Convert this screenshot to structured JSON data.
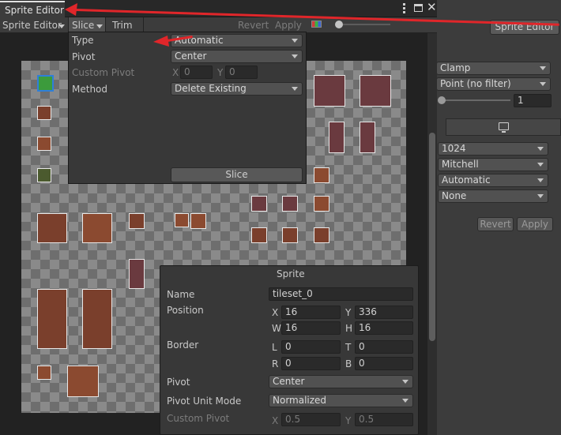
{
  "window": {
    "tab_title": "Sprite Editor",
    "toolbar": {
      "sprite_editor_menu": "Sprite Editor",
      "slice_menu": "Slice",
      "trim_button": "Trim",
      "revert_button": "Revert",
      "apply_button": "Apply"
    }
  },
  "slice_popup": {
    "type_label": "Type",
    "type_value": "Automatic",
    "pivot_label": "Pivot",
    "pivot_value": "Center",
    "custom_pivot_label": "Custom Pivot",
    "x_label": "X",
    "x_value": "0",
    "y_label": "Y",
    "y_value": "0",
    "method_label": "Method",
    "method_value": "Delete Existing",
    "slice_button": "Slice"
  },
  "sprite_panel": {
    "title": "Sprite",
    "name_label": "Name",
    "name_value": "tileset_0",
    "position_label": "Position",
    "pos_x_label": "X",
    "pos_x": "16",
    "pos_y_label": "Y",
    "pos_y": "336",
    "pos_w_label": "W",
    "pos_w": "16",
    "pos_h_label": "H",
    "pos_h": "16",
    "border_label": "Border",
    "border_l_label": "L",
    "border_l": "0",
    "border_t_label": "T",
    "border_t": "0",
    "border_r_label": "R",
    "border_r": "0",
    "border_b_label": "B",
    "border_b": "0",
    "pivot_label": "Pivot",
    "pivot_value": "Center",
    "pivot_unit_mode_label": "Pivot Unit Mode",
    "pivot_unit_mode_value": "Normalized",
    "custom_pivot_label": "Custom Pivot",
    "cp_x_label": "X",
    "cp_x": "0.5",
    "cp_y_label": "Y",
    "cp_y": "0.5"
  },
  "inspector": {
    "sprite_editor_button": "Sprite Editor",
    "wrap_mode": "Clamp",
    "filter_mode": "Point (no filter)",
    "aniso_value": "1",
    "max_size": "1024",
    "resize_algorithm": "Mitchell",
    "format": "Automatic",
    "compression": "None",
    "revert_button": "Revert",
    "apply_button": "Apply"
  },
  "icons": [
    "more-vert-icon",
    "maximize-icon",
    "close-icon",
    "rgb-channel-icon",
    "zoom-slider-icon",
    "monitor-icon",
    "annotation-arrow"
  ],
  "colors": {
    "annotation_red": "#e0262a",
    "selection_green": "#3c9b3c",
    "selection_blue": "#2f7fd9"
  }
}
